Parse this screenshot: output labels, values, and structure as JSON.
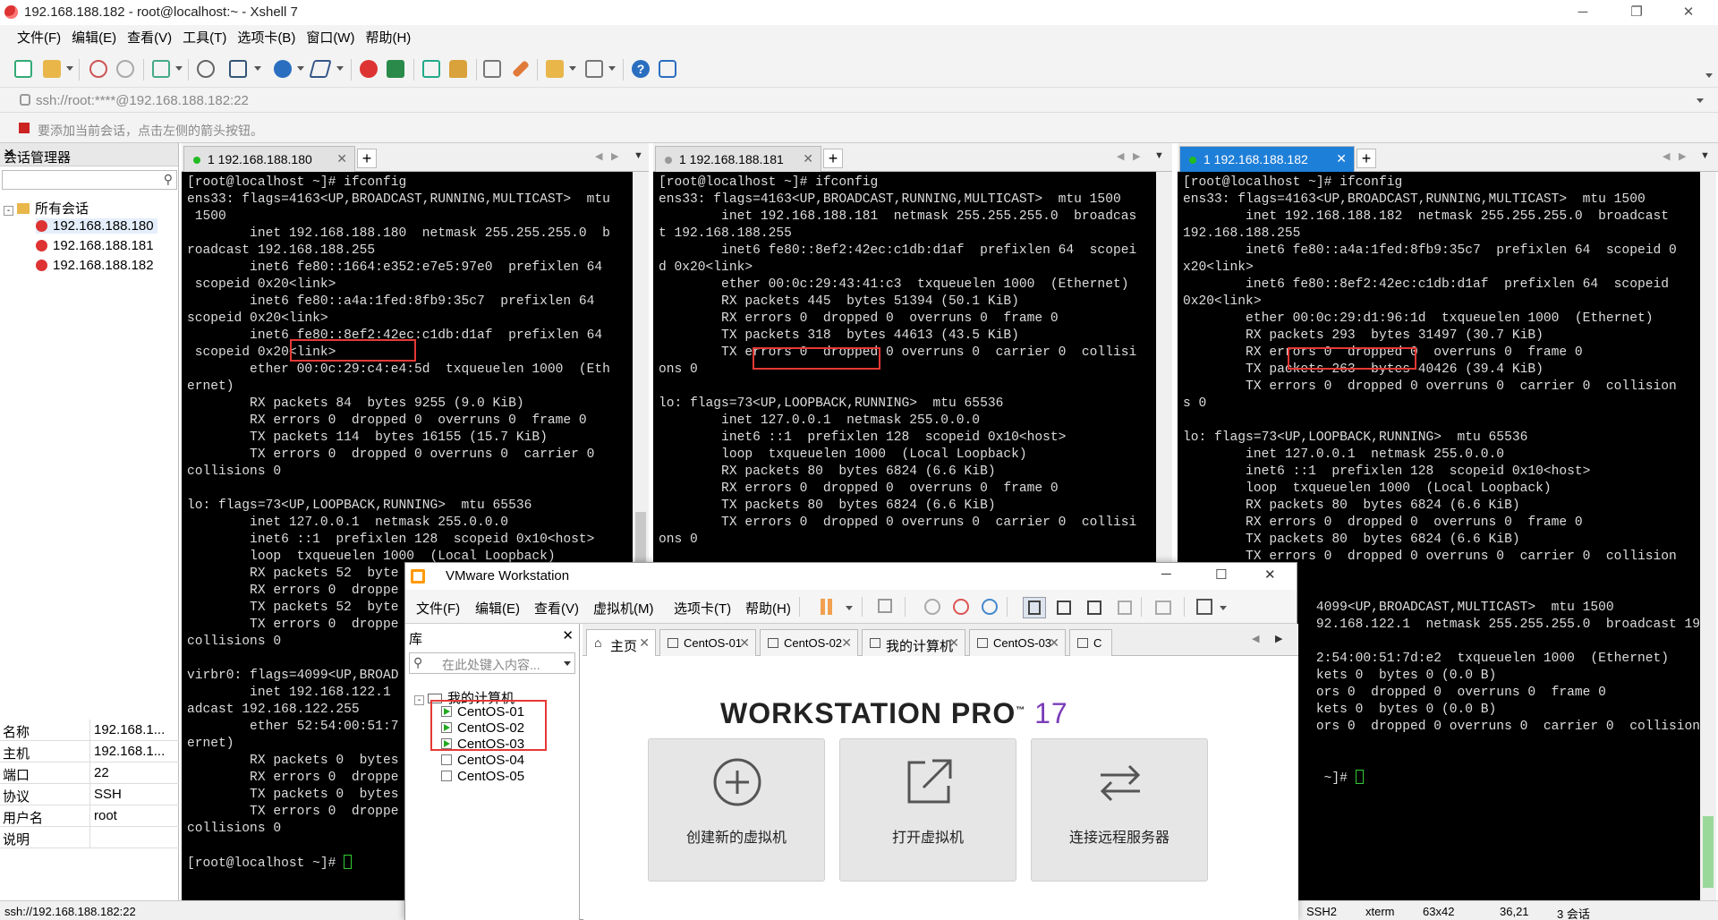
{
  "window": {
    "title": "192.168.188.182 - root@localhost:~ - Xshell 7"
  },
  "menu": [
    "文件(F)",
    "编辑(E)",
    "查看(V)",
    "工具(T)",
    "选项卡(B)",
    "窗口(W)",
    "帮助(H)"
  ],
  "address": {
    "value": "ssh://root:****@192.168.188.182:22"
  },
  "hint": {
    "text": "要添加当前会话，点击左侧的箭头按钮。"
  },
  "sessions": {
    "title": "会话管理器",
    "root": "所有会话",
    "items": [
      "192.168.188.180",
      "192.168.188.181",
      "192.168.188.182"
    ],
    "props": [
      {
        "k": "名称",
        "v": "192.168.1..."
      },
      {
        "k": "主机",
        "v": "192.168.1..."
      },
      {
        "k": "端口",
        "v": "22"
      },
      {
        "k": "协议",
        "v": "SSH"
      },
      {
        "k": "用户名",
        "v": "root"
      },
      {
        "k": "说明",
        "v": ""
      }
    ]
  },
  "panes": [
    {
      "tab": "1 192.168.188.180",
      "lines": [
        "[root@localhost ~]# ifconfig",
        "ens33: flags=4163<UP,BROADCAST,RUNNING,MULTICAST>  mtu",
        " 1500",
        "        inet 192.168.188.180  netmask 255.255.255.0  b",
        "roadcast 192.168.188.255",
        "        inet6 fe80::1664:e352:e7e5:97e0  prefixlen 64",
        " scopeid 0x20<link>",
        "        inet6 fe80::a4a:1fed:8fb9:35c7  prefixlen 64",
        "scopeid 0x20<link>",
        "        inet6 fe80::8ef2:42ec:c1db:d1af  prefixlen 64",
        " scopeid 0x20<link>",
        "        ether 00:0c:29:c4:e4:5d  txqueuelen 1000  (Eth",
        "ernet)",
        "        RX packets 84  bytes 9255 (9.0 KiB)",
        "        RX errors 0  dropped 0  overruns 0  frame 0",
        "        TX packets 114  bytes 16155 (15.7 KiB)",
        "        TX errors 0  dropped 0 overruns 0  carrier 0",
        "collisions 0",
        "",
        "lo: flags=73<UP,LOOPBACK,RUNNING>  mtu 65536",
        "        inet 127.0.0.1  netmask 255.0.0.0",
        "        inet6 ::1  prefixlen 128  scopeid 0x10<host>",
        "        loop  txqueuelen 1000  (Local Loopback)",
        "        RX packets 52  byte",
        "        RX errors 0  droppe",
        "        TX packets 52  byte",
        "        TX errors 0  droppe",
        "collisions 0",
        "",
        "virbr0: flags=4099<UP,BROAD",
        "        inet 192.168.122.1",
        "adcast 192.168.122.255",
        "        ether 52:54:00:51:7",
        "ernet)",
        "        RX packets 0  bytes",
        "        RX errors 0  droppe",
        "        TX packets 0  bytes",
        "        TX errors 0  droppe",
        "collisions 0",
        "",
        "[root@localhost ~]# "
      ]
    },
    {
      "tab": "1 192.168.188.181",
      "lines": [
        "[root@localhost ~]# ifconfig",
        "ens33: flags=4163<UP,BROADCAST,RUNNING,MULTICAST>  mtu 1500",
        "        inet 192.168.188.181  netmask 255.255.255.0  broadcas",
        "t 192.168.188.255",
        "        inet6 fe80::8ef2:42ec:c1db:d1af  prefixlen 64  scopei",
        "d 0x20<link>",
        "        ether 00:0c:29:43:41:c3  txqueuelen 1000  (Ethernet)",
        "        RX packets 445  bytes 51394 (50.1 KiB)",
        "        RX errors 0  dropped 0  overruns 0  frame 0",
        "        TX packets 318  bytes 44613 (43.5 KiB)",
        "        TX errors 0  dropped 0 overruns 0  carrier 0  collisi",
        "ons 0",
        "",
        "lo: flags=73<UP,LOOPBACK,RUNNING>  mtu 65536",
        "        inet 127.0.0.1  netmask 255.0.0.0",
        "        inet6 ::1  prefixlen 128  scopeid 0x10<host>",
        "        loop  txqueuelen 1000  (Local Loopback)",
        "        RX packets 80  bytes 6824 (6.6 KiB)",
        "        RX errors 0  dropped 0  overruns 0  frame 0",
        "        TX packets 80  bytes 6824 (6.6 KiB)",
        "        TX errors 0  dropped 0 overruns 0  carrier 0  collisi",
        "ons 0"
      ]
    },
    {
      "tab": "1 192.168.188.182",
      "lines": [
        "[root@localhost ~]# ifconfig",
        "ens33: flags=4163<UP,BROADCAST,RUNNING,MULTICAST>  mtu 1500",
        "        inet 192.168.188.182  netmask 255.255.255.0  broadcast",
        "192.168.188.255",
        "        inet6 fe80::a4a:1fed:8fb9:35c7  prefixlen 64  scopeid 0",
        "x20<link>",
        "        inet6 fe80::8ef2:42ec:c1db:d1af  prefixlen 64  scopeid",
        "0x20<link>",
        "        ether 00:0c:29:d1:96:1d  txqueuelen 1000  (Ethernet)",
        "        RX packets 293  bytes 31497 (30.7 KiB)",
        "        RX errors 0  dropped 0  overruns 0  frame 0",
        "        TX packets 263  bytes 40426 (39.4 KiB)",
        "        TX errors 0  dropped 0 overruns 0  carrier 0  collision",
        "s 0",
        "",
        "lo: flags=73<UP,LOOPBACK,RUNNING>  mtu 65536",
        "        inet 127.0.0.1  netmask 255.0.0.0",
        "        inet6 ::1  prefixlen 128  scopeid 0x10<host>",
        "        loop  txqueuelen 1000  (Local Loopback)",
        "        RX packets 80  bytes 6824 (6.6 KiB)",
        "        RX errors 0  dropped 0  overruns 0  frame 0",
        "        TX packets 80  bytes 6824 (6.6 KiB)",
        "        TX errors 0  dropped 0 overruns 0  carrier 0  collision",
        "",
        "",
        "                 4099<UP,BROADCAST,MULTICAST>  mtu 1500",
        "                 92.168.122.1  netmask 255.255.255.0  broadcast 19",
        "",
        "                 2:54:00:51:7d:e2  txqueuelen 1000  (Ethernet)",
        "                 kets 0  bytes 0 (0.0 B)",
        "                 ors 0  dropped 0  overruns 0  frame 0",
        "                 kets 0  bytes 0 (0.0 B)",
        "                 ors 0  dropped 0 overruns 0  carrier 0  collision",
        "",
        "",
        "                  ~]# "
      ]
    }
  ],
  "status": {
    "left": "ssh://192.168.188.182:22",
    "proto": "SSH2",
    "term": "xterm",
    "size": "63x42",
    "pos": "36,21",
    "sessions": "3 会话"
  },
  "vmware": {
    "title": "VMware Workstation",
    "menu": [
      "文件(F)",
      "编辑(E)",
      "查看(V)",
      "虚拟机(M)",
      "选项卡(T)",
      "帮助(H)"
    ],
    "library_title": "库",
    "search_placeholder": "在此处键入内容...",
    "tree_root": "我的计算机",
    "vms": [
      "CentOS-01",
      "CentOS-02",
      "CentOS-03",
      "CentOS-04",
      "CentOS-05"
    ],
    "tabs": [
      "主页",
      "CentOS-01",
      "CentOS-02",
      "我的计算机",
      "CentOS-03",
      "C"
    ],
    "brand": "WORKSTATION PRO",
    "version": "17",
    "cards": [
      "创建新的虚拟机",
      "打开虚拟机",
      "连接远程服务器"
    ]
  },
  "colors": {
    "highlight": "#e53935",
    "active_tab": "#1e7fd8",
    "accent": "#7a3db8"
  }
}
